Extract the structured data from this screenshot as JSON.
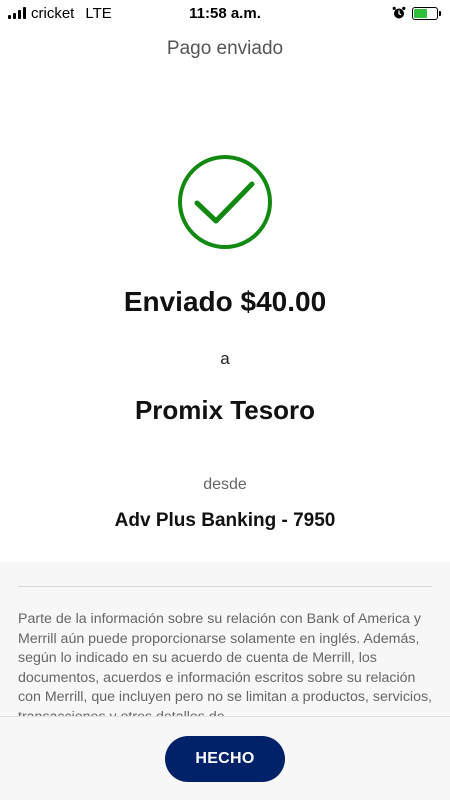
{
  "status_bar": {
    "carrier": "cricket",
    "network": "LTE",
    "time": "11:58 a.m."
  },
  "header": {
    "title": "Pago enviado"
  },
  "confirmation": {
    "icon": "checkmark-circle-icon",
    "icon_color": "#128a12",
    "headline": "Enviado $40.00",
    "to_label": "a",
    "recipient": "Promix Tesoro",
    "from_label": "desde",
    "account": "Adv Plus Banking - 7950"
  },
  "disclosure": {
    "text": "Parte de la información sobre su relación con Bank of America y Merrill aún puede proporcionarse solamente en inglés. Además, según lo indicado en su acuerdo de cuenta de Merrill, los documentos, acuerdos e información escritos sobre su relación con Merrill, que incluyen pero no se limitan a productos, servicios, transacciones y otros detalles de"
  },
  "footer": {
    "done_label": "HECHO",
    "button_color": "#012169"
  }
}
